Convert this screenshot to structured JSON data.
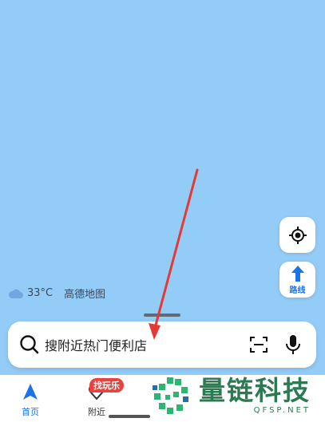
{
  "weather": {
    "temperature": "33°C",
    "brand": "高德地图",
    "icon": "cloud-icon"
  },
  "map_controls": {
    "locate_icon": "crosshair-icon",
    "route_label": "路线",
    "route_icon": "route-arrow-icon"
  },
  "search": {
    "placeholder": "搜附近热门便利店",
    "search_icon": "search-icon",
    "scan_icon": "scan-icon",
    "mic_icon": "mic-icon"
  },
  "tabs": [
    {
      "label": "首页",
      "icon": "navigation-arrow-icon",
      "active": true
    },
    {
      "label": "附近",
      "icon": "heart-location-icon",
      "active": false
    }
  ],
  "badge": "找玩乐",
  "watermark": {
    "title": "量链科技",
    "sub": "QFSP.NET"
  },
  "colors": {
    "map": "#94ccf8",
    "accent": "#1a73e8",
    "badge": "#e8423f",
    "arrow": "#e53935",
    "watermark": "#2b7a52"
  }
}
